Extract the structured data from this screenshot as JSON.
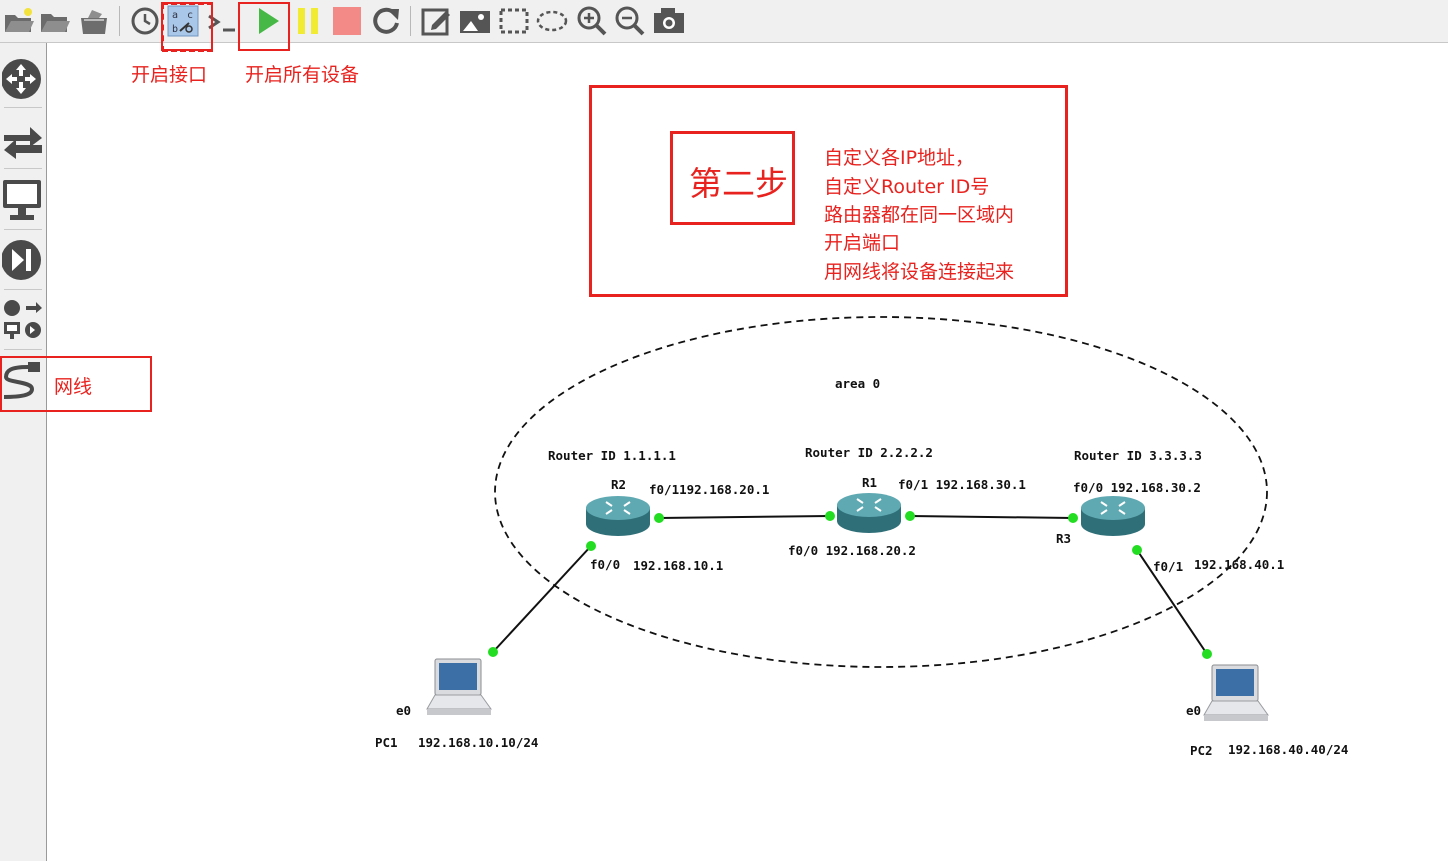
{
  "toolbar": {
    "buttons": [
      "open-project",
      "open-folder",
      "save-project",
      "snapshot-clock",
      "show-interface-labels",
      "console",
      "start-all",
      "suspend-all",
      "stop-all",
      "reload-all",
      "add-note",
      "insert-picture",
      "draw-rectangle",
      "draw-ellipse",
      "zoom-in",
      "zoom-out",
      "screenshot"
    ]
  },
  "sidebar": {
    "items": [
      "routers",
      "switches",
      "end-devices",
      "security-devices",
      "all-devices",
      "add-link"
    ]
  },
  "annotations": {
    "interface_label": "开启接口",
    "start_all_label": "开启所有设备",
    "cable_label": "网线",
    "step_title": "第二步",
    "step_lines": [
      "自定义各IP地址，",
      "自定义Router ID号",
      "路由器都在同一区域内",
      "开启端口",
      "用网线将设备连接起来"
    ]
  },
  "topology": {
    "area": "area 0",
    "r2": {
      "name": "R2",
      "router_id": "Router ID 1.1.1.1",
      "f01": "f0/1192.168.20.1",
      "f00": "f0/0",
      "f00_ip": "192.168.10.1"
    },
    "r1": {
      "name": "R1",
      "router_id": "Router ID 2.2.2.2",
      "f01": "f0/1 192.168.30.1",
      "f00": "f0/0 192.168.20.2"
    },
    "r3": {
      "name": "R3",
      "router_id": "Router ID 3.3.3.3",
      "f00": "f0/0 192.168.30.2",
      "f01": "f0/1",
      "f01_ip": "192.168.40.1"
    },
    "pc1": {
      "name": "PC1",
      "iface": "e0",
      "ip": "192.168.10.10/24"
    },
    "pc2": {
      "name": "PC2",
      "iface": "e0",
      "ip": "192.168.40.40/24"
    }
  },
  "colors": {
    "annotation_red": "#e8231f",
    "link_dot_green": "#22dd22",
    "router_teal": "#3f8c95"
  }
}
